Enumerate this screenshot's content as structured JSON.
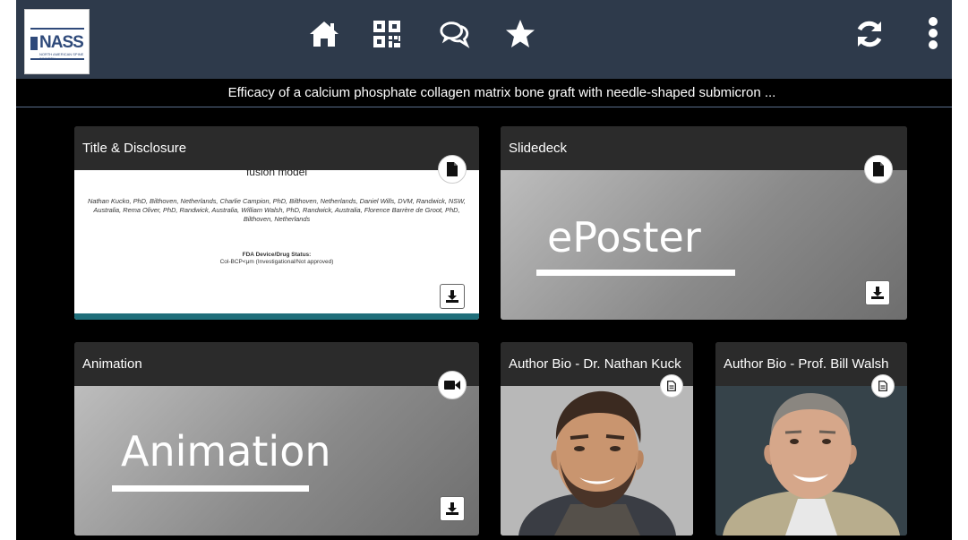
{
  "header": {
    "logo_text": "NASS",
    "logo_subtext": "NORTH AMERICAN SPINE SOCIETY",
    "icons": [
      "home-icon",
      "qr-code-icon",
      "chat-icon",
      "star-icon",
      "refresh-icon",
      "more-vert-icon"
    ]
  },
  "title_strip": {
    "text": "Efficacy of a calcium phosphate collagen matrix bone graft with needle-shaped submicron ..."
  },
  "cards": {
    "title_disclosure": {
      "title": "Title & Disclosure",
      "type_icon": "document-icon",
      "slide": {
        "cut_line": "fusion model",
        "authors": "Nathan Kucko, PhD, Bilthoven, Netherlands, Charlie Campion, PhD, Bilthoven, Netherlands, Daniel Wills, DVM, Randwick, NSW, Australia, Rema Oliver, PhD, Randwick, Australia, William Walsh, PhD, Randwick, Australia, Florence Barrère de Groot, PhD, Bilthoven, Netherlands",
        "fda_heading": "FDA Device/Drug Status:",
        "fda_value": "Col-BCP<μm (Investigational/Not approved)"
      }
    },
    "slidedeck": {
      "title": "Slidedeck",
      "type_icon": "document-icon",
      "big_word": "ePoster"
    },
    "animation": {
      "title": "Animation",
      "type_icon": "video-icon",
      "big_word": "Animation"
    },
    "author_bio_1": {
      "title": "Author Bio - Dr. Nathan Kuck",
      "type_icon": "text-document-icon"
    },
    "author_bio_2": {
      "title": "Author Bio - Prof. Bill Walsh",
      "type_icon": "text-document-icon"
    }
  },
  "colors": {
    "topbar": "#2e3a4b",
    "background": "#000000",
    "card_header": "#2b2b2b",
    "nass_blue": "#2f4a7a"
  }
}
